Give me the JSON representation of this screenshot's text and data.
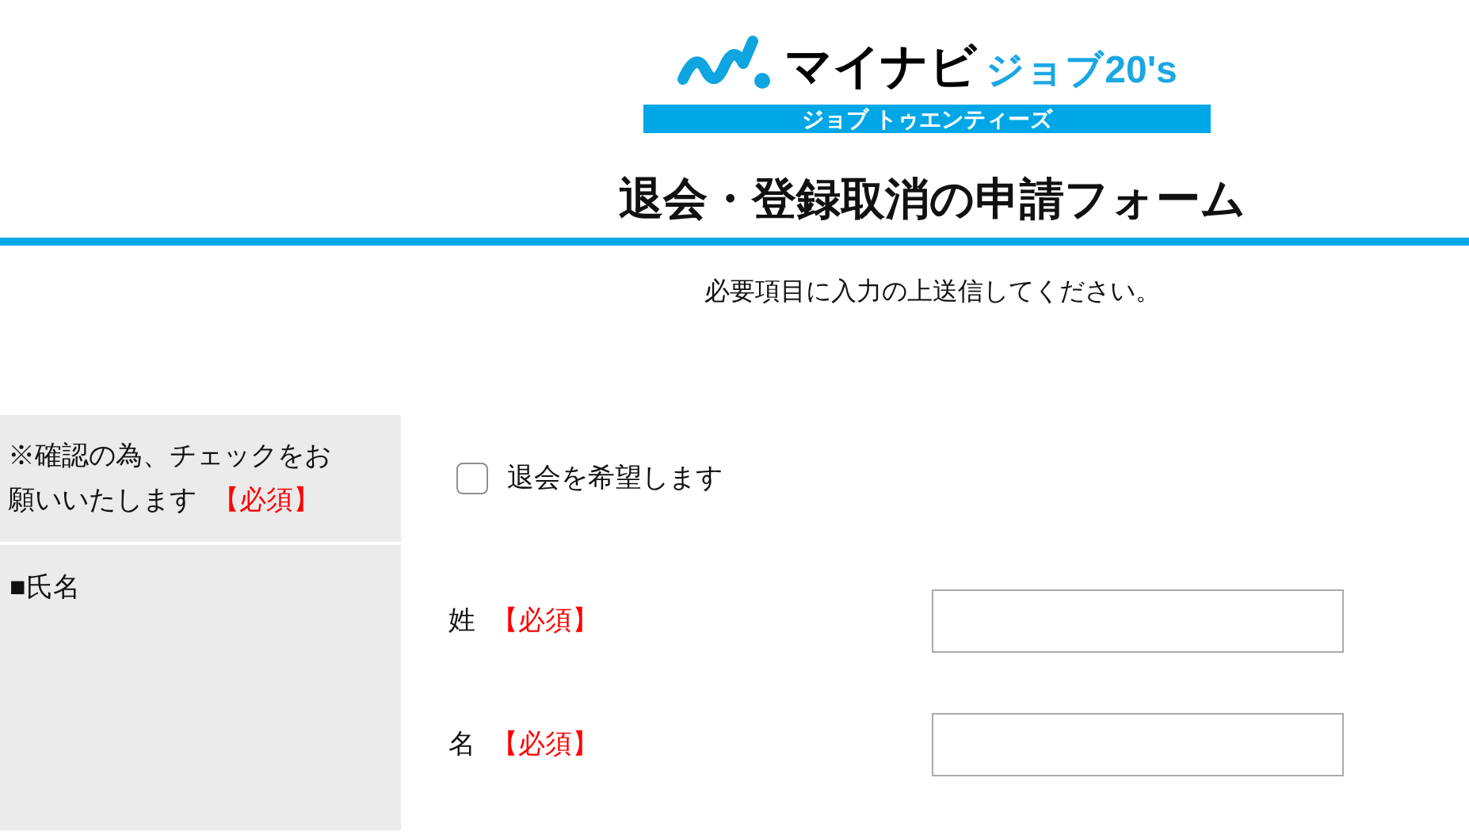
{
  "logo": {
    "brand": "マイナビ",
    "product": "ジョブ20's",
    "reading": "ジョブ トゥエンティーズ"
  },
  "title": "退会・登録取消の申請フォーム",
  "instruction": "必要項目に入力の上送信してください。",
  "rows": [
    {
      "kind": "checkbox",
      "label": "※確認の為、チェックをお願いいたします",
      "required": "【必須】",
      "option": {
        "label": "退会を希望します",
        "checked": false
      }
    },
    {
      "kind": "name",
      "label": "■氏名",
      "fields": [
        {
          "label": "姓",
          "required": "【必須】"
        },
        {
          "label": "名",
          "required": "【必須】"
        }
      ]
    }
  ]
}
